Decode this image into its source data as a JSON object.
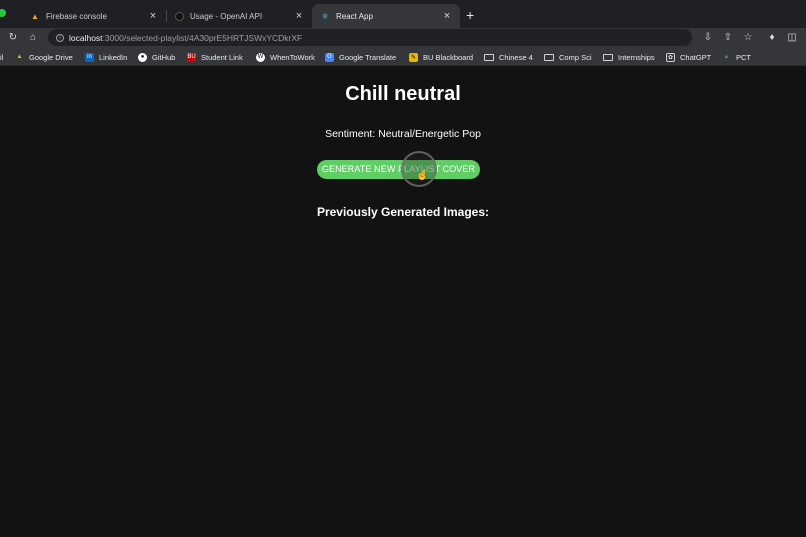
{
  "browser": {
    "tabs": [
      {
        "title": "Firebase console",
        "icon": "firebase-icon"
      },
      {
        "title": "Usage - OpenAI API",
        "icon": "openai-icon"
      },
      {
        "title": "React App",
        "icon": "react-icon",
        "active": true
      }
    ],
    "url": {
      "host": "localhost",
      "path": ":3000/selected-playlist/4A30prE5HRTJSWxYCDkrXF"
    },
    "bookmarks": [
      {
        "label": "il"
      },
      {
        "label": "Google Drive",
        "icon": "google-drive-icon"
      },
      {
        "label": "LinkedIn",
        "icon": "linkedin-icon"
      },
      {
        "label": "GitHub",
        "icon": "github-icon"
      },
      {
        "label": "Student Link",
        "icon": "bu-icon"
      },
      {
        "label": "WhenToWork",
        "icon": "whentowork-icon"
      },
      {
        "label": "Google Translate",
        "icon": "google-translate-icon"
      },
      {
        "label": "BU Blackboard",
        "icon": "blackboard-icon"
      },
      {
        "label": "Chinese 4",
        "icon": "folder-icon"
      },
      {
        "label": "Comp Sci",
        "icon": "folder-icon"
      },
      {
        "label": "Internships",
        "icon": "folder-icon"
      },
      {
        "label": "ChatGPT",
        "icon": "chatgpt-icon"
      },
      {
        "label": "PCT",
        "icon": "google-drive-icon"
      }
    ]
  },
  "page": {
    "playlist_title": "Chill neutral",
    "sentiment": "Sentiment: Neutral/Energetic Pop",
    "generate_button": "GENERATE NEW PLAYLIST COVER",
    "previous_heading": "Previously Generated Images:"
  },
  "colors": {
    "background": "#121212",
    "button": "#5fcf65"
  }
}
